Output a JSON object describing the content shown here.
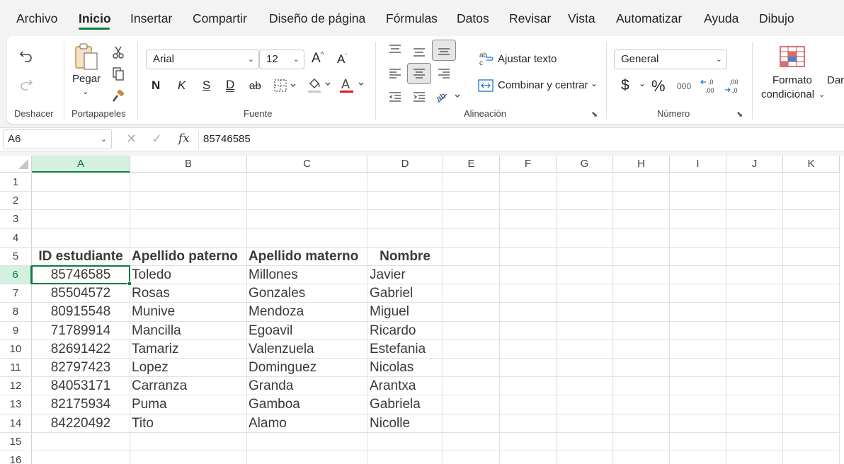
{
  "menu": {
    "items": [
      "Archivo",
      "Inicio",
      "Insertar",
      "Compartir",
      "Diseño de página",
      "Fórmulas",
      "Datos",
      "Revisar",
      "Vista",
      "Automatizar",
      "Ayuda",
      "Dibujo"
    ],
    "active": "Inicio"
  },
  "ribbon": {
    "undo_group": {
      "label": "Deshacer"
    },
    "clipboard": {
      "label": "Portapapeles",
      "paste_label": "Pegar"
    },
    "font": {
      "label": "Fuente",
      "font_name": "Arial",
      "font_size": "12",
      "bold": "N",
      "italic": "K",
      "strike": "S",
      "underline": "D",
      "strike2": "ab",
      "font_color": "#e81123"
    },
    "alignment": {
      "label": "Alineación",
      "wrap_text": "Ajustar texto",
      "merge_center": "Combinar y centrar"
    },
    "number": {
      "label": "Número",
      "format": "General",
      "currency": "$",
      "percent": "%",
      "thousands": "000"
    },
    "styles": {
      "conditional_line1": "Formato",
      "conditional_line2": "condicional",
      "next_cut": "Dar"
    }
  },
  "formula_bar": {
    "name_box": "A6",
    "fx": "fx",
    "value": "85746585"
  },
  "sheet": {
    "columns": [
      "A",
      "B",
      "C",
      "D",
      "E",
      "F",
      "G",
      "H",
      "I",
      "J",
      "K"
    ],
    "rows": [
      "1",
      "2",
      "3",
      "4",
      "5",
      "6",
      "7",
      "8",
      "9",
      "10",
      "11",
      "12",
      "13",
      "14",
      "15",
      "16"
    ],
    "selected_column": "A",
    "selected_row": "6",
    "headers": [
      "ID estudiante",
      "Apellido paterno",
      "Apellido materno",
      "Nombre"
    ],
    "records": [
      [
        "85746585",
        "Toledo",
        "Millones",
        "Javier"
      ],
      [
        "85504572",
        "Rosas",
        "Gonzales",
        "Gabriel"
      ],
      [
        "80915548",
        "Munive",
        "Mendoza",
        "Miguel"
      ],
      [
        "71789914",
        "Mancilla",
        "Egoavil",
        "Ricardo"
      ],
      [
        "82691422",
        "Tamariz",
        "Valenzuela",
        "Estefania"
      ],
      [
        "82797423",
        "Lopez",
        "Dominguez",
        "Nicolas"
      ],
      [
        "84053171",
        "Carranza",
        "Granda",
        "Arantxa"
      ],
      [
        "82175934",
        "Puma",
        "Gamboa",
        "Gabriela"
      ],
      [
        "84220492",
        "Tito",
        "Alamo",
        "Nicolle"
      ]
    ]
  },
  "colors": {
    "accent": "#107c41",
    "selected_header_bg": "#d3f0e0"
  }
}
